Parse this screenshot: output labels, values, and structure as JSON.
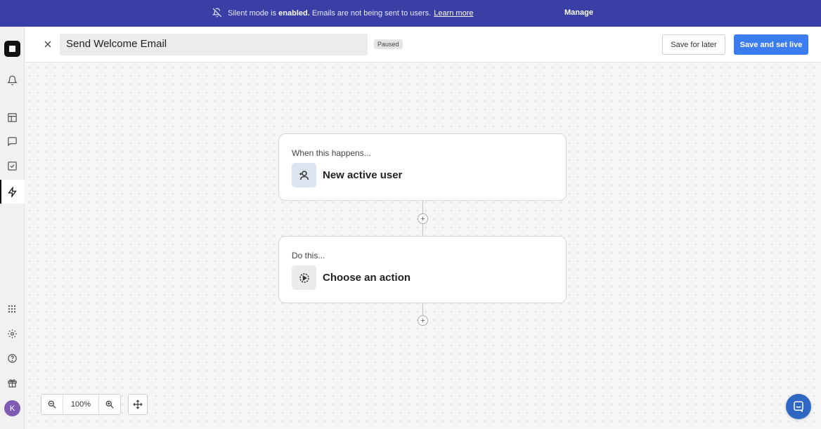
{
  "banner": {
    "prefix": "Silent mode is",
    "bold": "enabled.",
    "suffix": "Emails are not being sent to users.",
    "link": "Learn more",
    "manage": "Manage",
    "bg": "#3a3fa6"
  },
  "sidebar": {
    "icons": [
      "logo",
      "bell-icon",
      "layout-icon",
      "message-icon",
      "checklist-icon",
      "bolt-icon",
      "apps-icon",
      "gear-icon",
      "help-icon",
      "gift-icon"
    ],
    "active": "bolt-icon",
    "avatar": "K"
  },
  "header": {
    "title": "Send Welcome Email",
    "status": "Paused",
    "save_later": "Save for later",
    "save_live": "Save and set live",
    "accent": "#3b7cf0"
  },
  "flow": {
    "trigger": {
      "label": "When this happens...",
      "value": "New active user",
      "icon": "user-plus-icon"
    },
    "action": {
      "label": "Do this...",
      "value": "Choose an action",
      "icon": "play-circle-icon"
    }
  },
  "zoom": {
    "value": "100%"
  }
}
